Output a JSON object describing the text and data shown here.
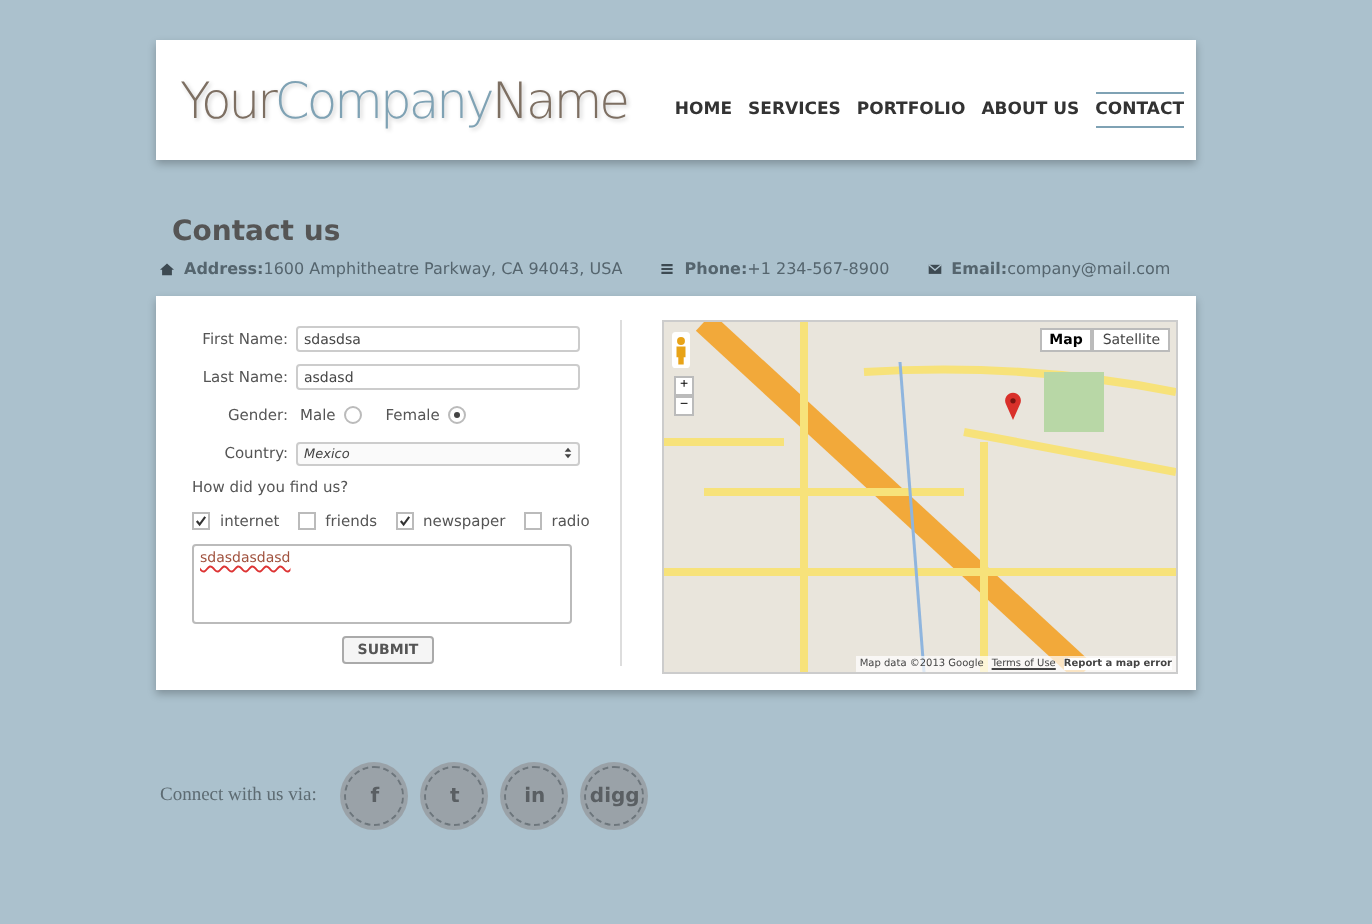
{
  "logo": {
    "part_1": "Your",
    "part_2": "Company",
    "part_3": "Name"
  },
  "nav": [
    {
      "label": "HOME",
      "selected": false
    },
    {
      "label": "SERVICES",
      "selected": false
    },
    {
      "label": "PORTFOLIO",
      "selected": false
    },
    {
      "label": "ABOUT US",
      "selected": false
    },
    {
      "label": "CONTACT",
      "selected": true
    }
  ],
  "heading": "Contact us",
  "contact_info": [
    {
      "kind": "address",
      "label": "Address:",
      "value": "1600 Amphitheatre Parkway, CA 94043, USA"
    },
    {
      "kind": "phone",
      "label": "Phone:",
      "value": "+1 234-567-8900"
    },
    {
      "kind": "email",
      "label": "Email:",
      "value": "company@mail.com"
    }
  ],
  "form": {
    "first_name": {
      "label": "First Name:",
      "value": "sdasdsa"
    },
    "last_name": {
      "label": "Last Name:",
      "value": "asdasd"
    },
    "gender": {
      "label": "Gender:",
      "options": [
        {
          "label": "Male",
          "selected": false
        },
        {
          "label": "Female",
          "selected": true
        }
      ]
    },
    "country": {
      "label": "Country:",
      "value": "Mexico"
    },
    "question": "How did you find us?",
    "sources": [
      {
        "label": "internet",
        "checked": true
      },
      {
        "label": "friends",
        "checked": false
      },
      {
        "label": "newspaper",
        "checked": true
      },
      {
        "label": "radio",
        "checked": false
      }
    ],
    "message": "sdasdasdasd",
    "submit": "SUBMIT"
  },
  "map": {
    "tabs": [
      {
        "label": "Map",
        "selected": true
      },
      {
        "label": "Satellite",
        "selected": false
      }
    ],
    "attribution": "Map data ©2013 Google",
    "terms": "Terms of Use",
    "report": "Report a map error",
    "zoom_in": "+",
    "zoom_out": "−"
  },
  "social": {
    "label": "Connect with us via:",
    "links": [
      "f",
      "t",
      "in",
      "digg"
    ]
  }
}
